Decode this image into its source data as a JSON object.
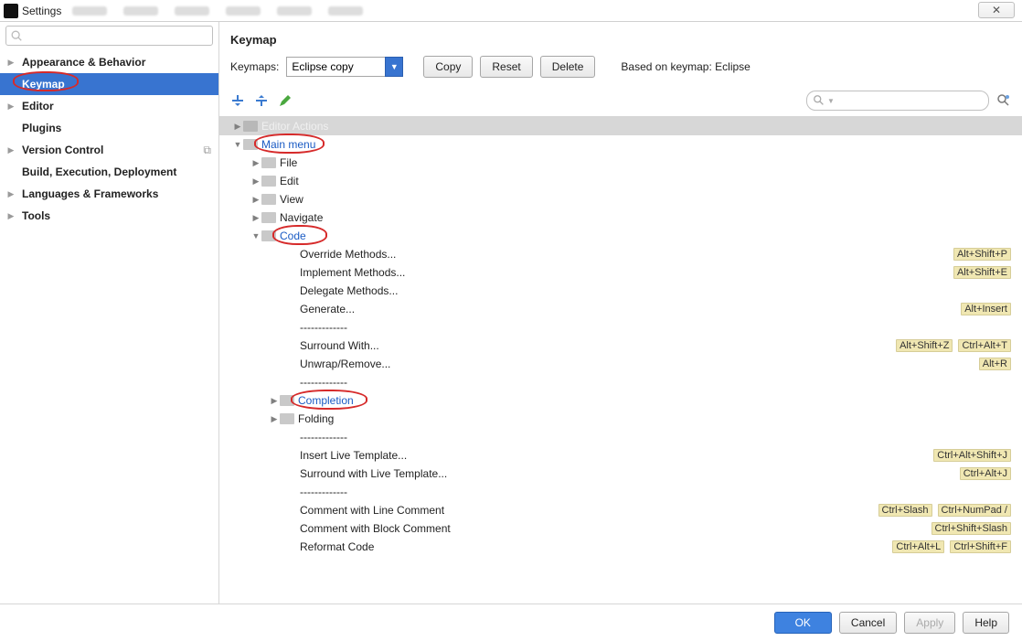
{
  "window": {
    "title": "Settings",
    "close_glyph": "✕"
  },
  "sidebar": {
    "items": [
      {
        "label": "Appearance & Behavior",
        "arrow": true
      },
      {
        "label": "Keymap",
        "arrow": false,
        "selected": true,
        "circled": true
      },
      {
        "label": "Editor",
        "arrow": true
      },
      {
        "label": "Plugins",
        "arrow": false
      },
      {
        "label": "Version Control",
        "arrow": true,
        "right_icon": true
      },
      {
        "label": "Build, Execution, Deployment",
        "arrow": false
      },
      {
        "label": "Languages & Frameworks",
        "arrow": true
      },
      {
        "label": "Tools",
        "arrow": true
      }
    ]
  },
  "content": {
    "header": "Keymap",
    "keymaps_label": "Keymaps:",
    "keymaps_value": "Eclipse copy",
    "copy_btn": "Copy",
    "reset_btn": "Reset",
    "delete_btn": "Delete",
    "based_on": "Based on keymap: Eclipse"
  },
  "tree": [
    {
      "indent": 0,
      "arrow": "▶",
      "folder": true,
      "label": "Editor Actions",
      "selected": true
    },
    {
      "indent": 0,
      "arrow": "▼",
      "folder": true,
      "label": "Main menu",
      "link": true,
      "circled": true
    },
    {
      "indent": 1,
      "arrow": "▶",
      "folder": true,
      "label": "File"
    },
    {
      "indent": 1,
      "arrow": "▶",
      "folder": true,
      "label": "Edit"
    },
    {
      "indent": 1,
      "arrow": "▶",
      "folder": true,
      "label": "View"
    },
    {
      "indent": 1,
      "arrow": "▶",
      "folder": true,
      "label": "Navigate"
    },
    {
      "indent": 1,
      "arrow": "▼",
      "folder": true,
      "label": "Code",
      "link": true,
      "circled": true
    },
    {
      "indent": 2,
      "label": "Override Methods...",
      "shortcuts": [
        "Alt+Shift+P"
      ]
    },
    {
      "indent": 2,
      "label": "Implement Methods...",
      "shortcuts": [
        "Alt+Shift+E"
      ]
    },
    {
      "indent": 2,
      "label": "Delegate Methods..."
    },
    {
      "indent": 2,
      "label": "Generate...",
      "shortcuts": [
        "Alt+Insert"
      ]
    },
    {
      "indent": 2,
      "label": "-------------"
    },
    {
      "indent": 2,
      "label": "Surround With...",
      "shortcuts": [
        "Alt+Shift+Z",
        "Ctrl+Alt+T"
      ]
    },
    {
      "indent": 2,
      "label": "Unwrap/Remove...",
      "shortcuts": [
        "Alt+R"
      ]
    },
    {
      "indent": 2,
      "label": "-------------"
    },
    {
      "indent": 2,
      "arrow": "▶",
      "folder": true,
      "label": "Completion",
      "link": true,
      "circled": true
    },
    {
      "indent": 2,
      "arrow": "▶",
      "folder": true,
      "label": "Folding"
    },
    {
      "indent": 2,
      "label": "-------------"
    },
    {
      "indent": 2,
      "label": "Insert Live Template...",
      "shortcuts": [
        "Ctrl+Alt+Shift+J"
      ]
    },
    {
      "indent": 2,
      "label": "Surround with Live Template...",
      "shortcuts": [
        "Ctrl+Alt+J"
      ]
    },
    {
      "indent": 2,
      "label": "-------------"
    },
    {
      "indent": 2,
      "label": "Comment with Line Comment",
      "shortcuts": [
        "Ctrl+Slash",
        "Ctrl+NumPad /"
      ]
    },
    {
      "indent": 2,
      "label": "Comment with Block Comment",
      "shortcuts": [
        "Ctrl+Shift+Slash"
      ]
    },
    {
      "indent": 2,
      "label": "Reformat Code",
      "shortcuts": [
        "Ctrl+Alt+L",
        "Ctrl+Shift+F"
      ]
    }
  ],
  "footer": {
    "ok": "OK",
    "cancel": "Cancel",
    "apply": "Apply",
    "help": "Help"
  }
}
